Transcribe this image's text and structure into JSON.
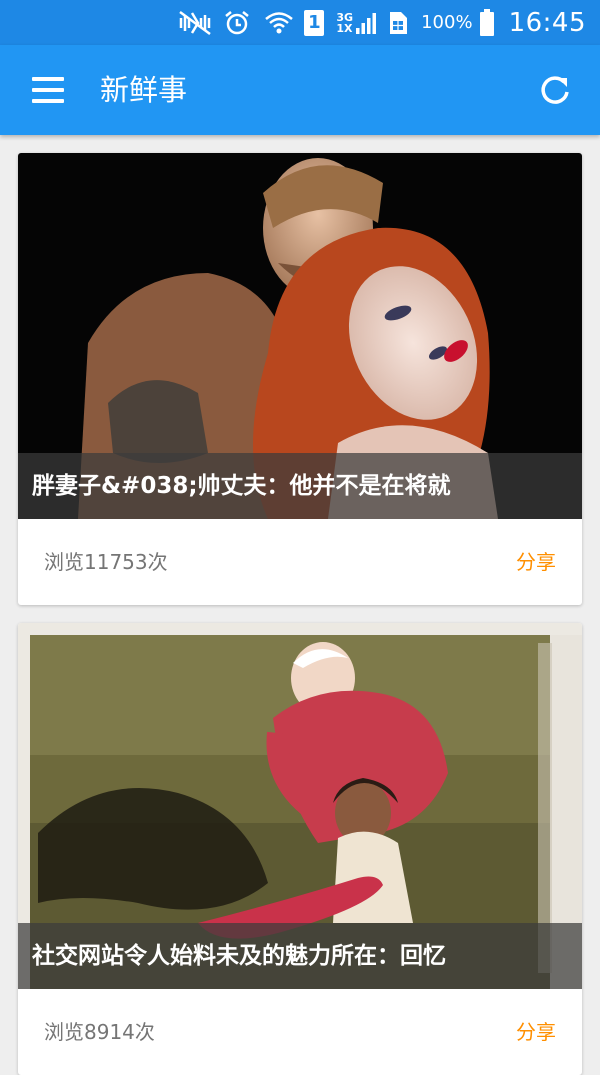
{
  "status_bar": {
    "time": "16:45",
    "battery_percent": "100%",
    "sim_slot": "1",
    "network_top": "3G",
    "network_bottom": "1X",
    "icons": [
      "mute-icon",
      "alarm-icon",
      "wifi-icon",
      "sim-1-icon",
      "signal-icon",
      "sim-card-icon",
      "battery-icon"
    ]
  },
  "app_bar": {
    "title": "新鲜事",
    "icons": [
      "menu-icon",
      "refresh-icon"
    ]
  },
  "cards": [
    {
      "caption": "胖妻子&#038;帅丈夫：他并不是在将就",
      "views": "浏览11753次",
      "share": "分享"
    },
    {
      "caption": "社交网站令人始料未及的魅力所在：回忆",
      "views": "浏览8914次",
      "share": "分享"
    }
  ],
  "colors": {
    "status_bar": "#1e88e5",
    "app_bar": "#2196f3",
    "share_accent": "#ff8f00",
    "background": "#eeeeee"
  }
}
